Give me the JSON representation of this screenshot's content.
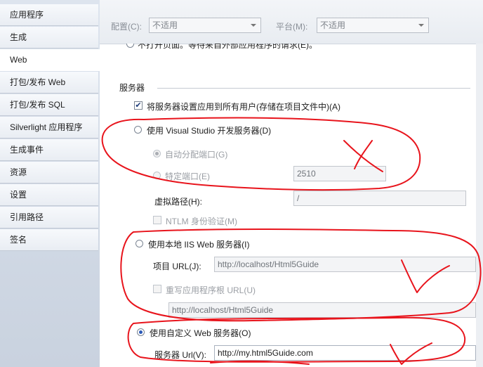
{
  "sidebar": {
    "items": [
      {
        "label": "应用程序"
      },
      {
        "label": "生成"
      },
      {
        "label": "Web"
      },
      {
        "label": "打包/发布 Web"
      },
      {
        "label": "打包/发布 SQL"
      },
      {
        "label": "Silverlight 应用程序"
      },
      {
        "label": "生成事件"
      },
      {
        "label": "资源"
      },
      {
        "label": "设置"
      },
      {
        "label": "引用路径"
      },
      {
        "label": "签名"
      }
    ],
    "selected_index": 2
  },
  "topbar": {
    "config_label": "配置(C):",
    "config_value": "不适用",
    "platform_label": "平台(M):",
    "platform_value": "不适用"
  },
  "clipped_line": "不打开页面。等待来自外部应用程序的请求(E)。",
  "servers": {
    "section_title": "服务器",
    "apply_all_users_label": "将服务器设置应用到所有用户(存储在项目文件中)(A)",
    "apply_all_users_checked": true,
    "vs_dev_server_label": "使用 Visual Studio 开发服务器(D)",
    "auto_port_label": "自动分配端口(G)",
    "specific_port_label": "特定端口(E)",
    "specific_port_value": "2510",
    "virtual_path_label": "虚拟路径(H):",
    "virtual_path_value": "/",
    "ntlm_label": "NTLM 身份验证(M)",
    "local_iis_label": "使用本地 IIS Web 服务器(I)",
    "project_url_label": "项目 URL(J):",
    "project_url_value": "http://localhost/Html5Guide",
    "override_root_label": "重写应用程序根 URL(U)",
    "override_root_value": "http://localhost/Html5Guide",
    "custom_server_label": "使用自定义 Web 服务器(O)",
    "server_url_label": "服务器 Url(V):",
    "server_url_value": "http://my.html5Guide.com",
    "selected_server": "custom"
  },
  "annotation_color": "#e8141c"
}
